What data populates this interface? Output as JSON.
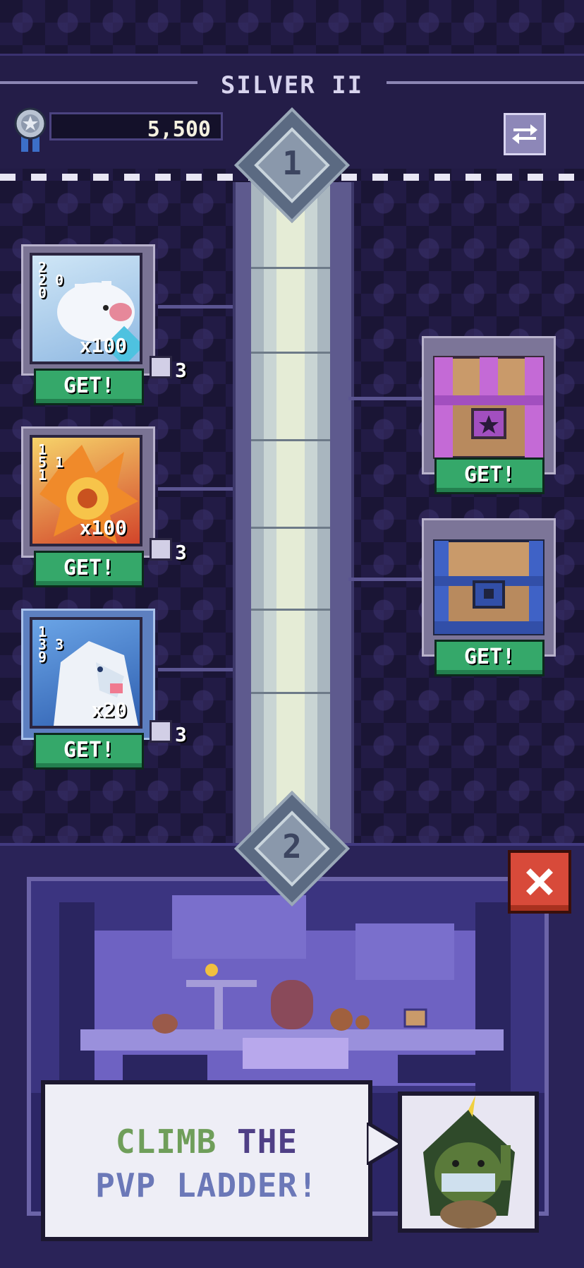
{
  "header": {
    "tier": "SILVER II",
    "score": "5,500"
  },
  "ranks": [
    "1",
    "2"
  ],
  "rewards": [
    {
      "stats": "2\n2 0\n0",
      "qty": "x100",
      "button": "GET!",
      "dice_count": "3",
      "art": "ice-bear"
    },
    {
      "stats": "1\n5 1\n1",
      "qty": "x100",
      "button": "GET!",
      "dice_count": "3",
      "art": "fire-beast"
    },
    {
      "stats": "1\n3 3\n9",
      "qty": "x20",
      "button": "GET!",
      "dice_count": "3",
      "art": "frost-wolf"
    }
  ],
  "chests": [
    {
      "button": "GET!",
      "color": "#b35fc8"
    },
    {
      "button": "GET!",
      "color": "#3f5fc0"
    }
  ],
  "dialog": {
    "line1_word1": "CLIMB",
    "line1_word2": "THE",
    "line2": "PVP LADDER!"
  }
}
